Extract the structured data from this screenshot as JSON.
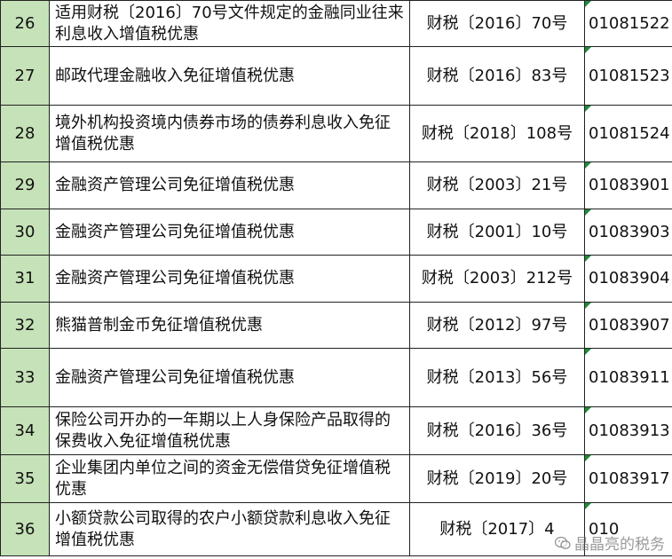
{
  "rows": [
    {
      "num": "26",
      "name": "适用财税〔2016〕70号文件规定的金融同业往来利息收入增值税优惠",
      "doc": "财税〔2016〕70号",
      "code": "01081522"
    },
    {
      "num": "27",
      "name": "邮政代理金融收入免征增值税优惠",
      "doc": "财税〔2016〕83号",
      "code": "01081523"
    },
    {
      "num": "28",
      "name": "境外机构投资境内债券市场的债券利息收入免征增值税优惠",
      "doc": "财税〔2018〕108号",
      "code": "01081524"
    },
    {
      "num": "29",
      "name": "金融资产管理公司免征增值税优惠",
      "doc": "财税〔2003〕21号",
      "code": "01083901"
    },
    {
      "num": "30",
      "name": "金融资产管理公司免征增值税优惠",
      "doc": "财税〔2001〕10号",
      "code": "01083903"
    },
    {
      "num": "31",
      "name": "金融资产管理公司免征增值税优惠",
      "doc": "财税〔2003〕212号",
      "code": "01083904"
    },
    {
      "num": "32",
      "name": "熊猫普制金币免征增值税优惠",
      "doc": "财税〔2012〕97号",
      "code": "01083907"
    },
    {
      "num": "33",
      "name": "金融资产管理公司免征增值税优惠",
      "doc": "财税〔2013〕56号",
      "code": "01083911"
    },
    {
      "num": "34",
      "name": "保险公司开办的一年期以上人身保险产品取得的保费收入免征增值税优惠",
      "doc": "财税〔2016〕36号",
      "code": "01083913"
    },
    {
      "num": "35",
      "name": "企业集团内单位之间的资金无偿借贷免征增值税优惠",
      "doc": "财税〔2019〕20号",
      "code": "01083917"
    },
    {
      "num": "36",
      "name": "小额贷款公司取得的农户小额贷款利息收入免征增值税优惠",
      "doc": "财税〔2017〕4",
      "code": "010"
    }
  ],
  "watermark": {
    "text": "晶晶亮的税务",
    "icon": "wechat-icon"
  }
}
